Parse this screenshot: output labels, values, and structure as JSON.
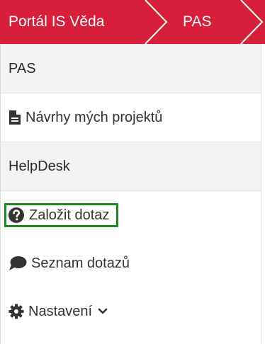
{
  "breadcrumb": {
    "items": [
      {
        "label": "Portál IS Věda"
      },
      {
        "label": "PAS"
      }
    ],
    "color": "#d71f3b"
  },
  "menu": {
    "sections": [
      {
        "title": "PAS",
        "items": [
          {
            "label": "Návrhy mých projektů",
            "icon": "file-text-icon"
          }
        ]
      },
      {
        "title": "HelpDesk",
        "items": [
          {
            "label": "Založit dotaz",
            "icon": "question-circle-icon",
            "highlighted": true
          },
          {
            "label": "Seznam dotazů",
            "icon": "comment-icon"
          },
          {
            "label": "Nastavení",
            "icon": "cog-icon",
            "dropdown": true
          }
        ]
      }
    ]
  },
  "highlight_color": "#1a8a1e"
}
